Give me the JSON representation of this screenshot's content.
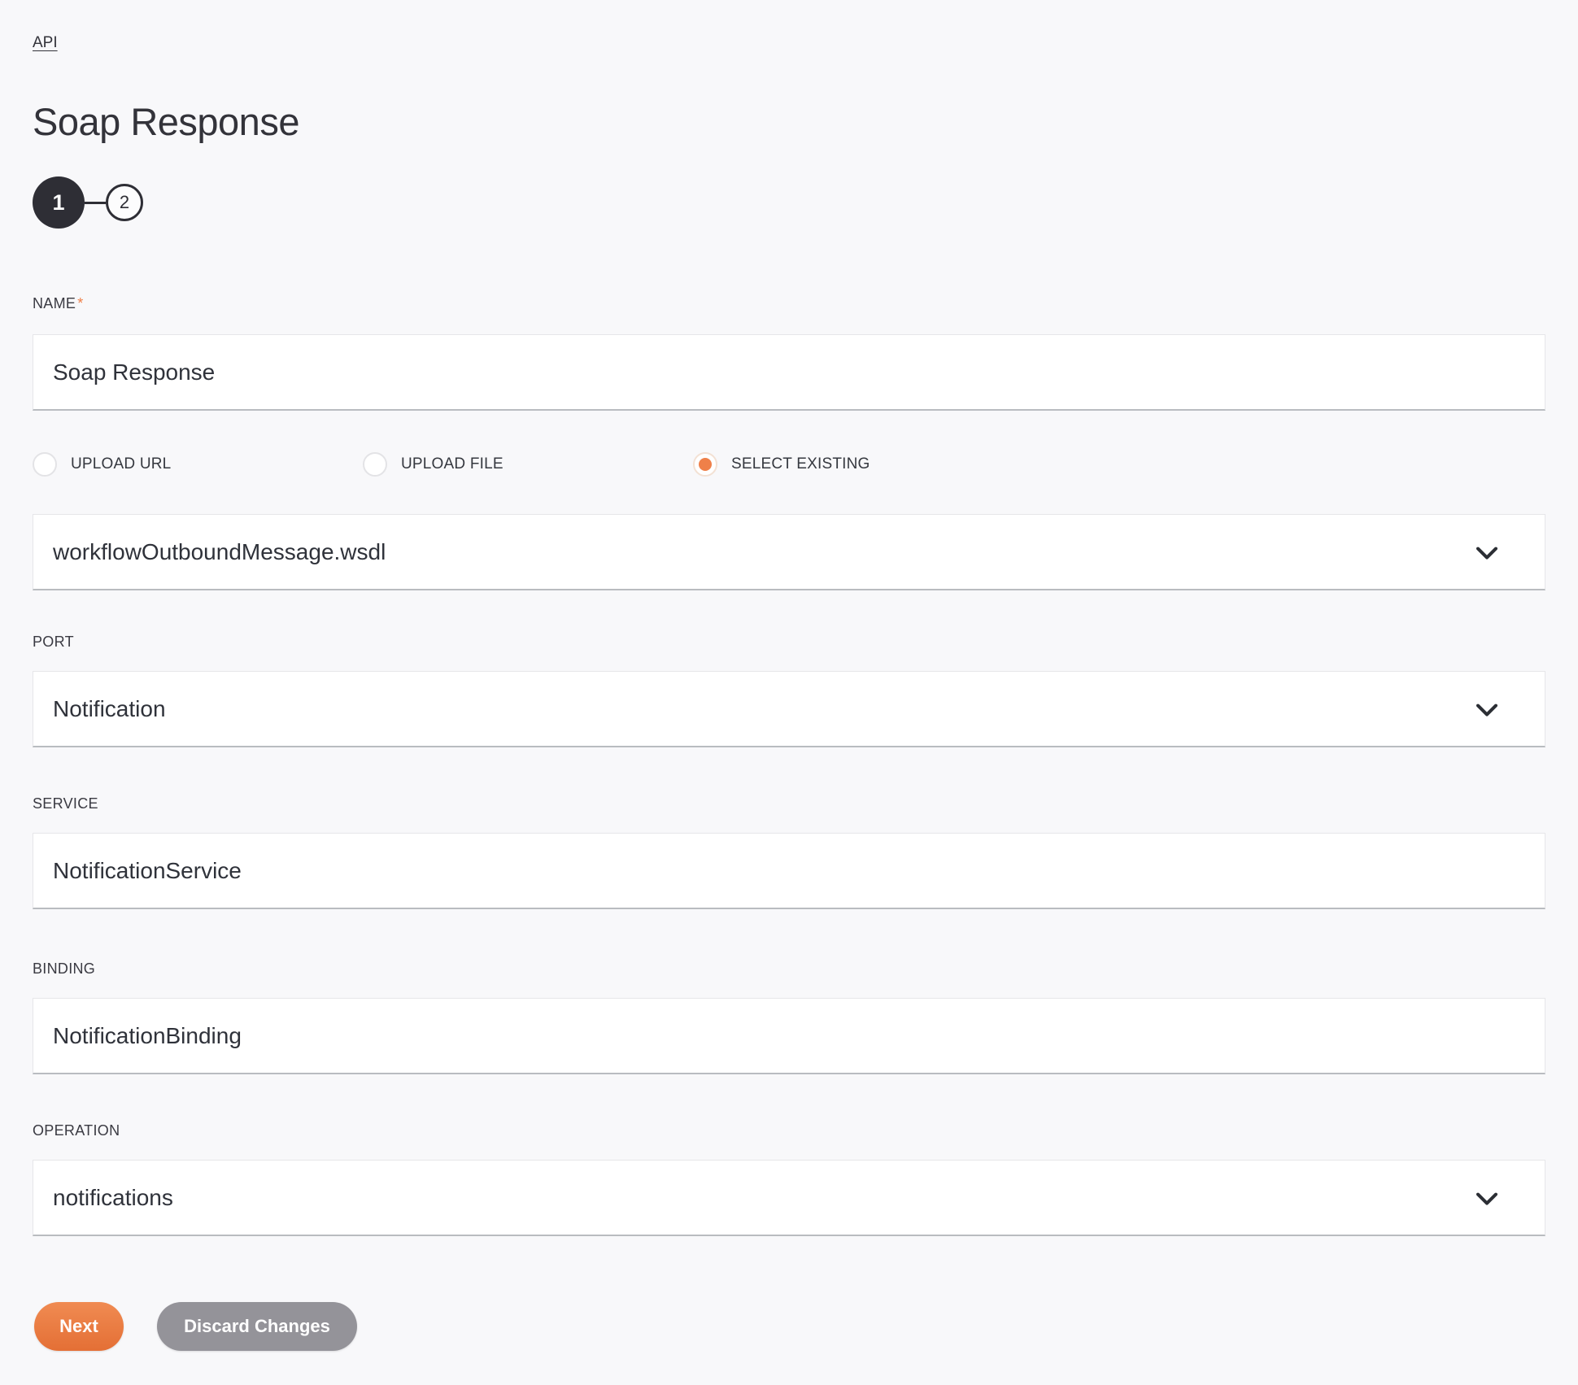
{
  "colors": {
    "background": "#f8f8fa",
    "accent_orange": "#ef8049",
    "stepper_dark": "#2e2e35",
    "button_gray": "#949399"
  },
  "breadcrumb": {
    "label": "API"
  },
  "header": {
    "title": "Soap Response"
  },
  "stepper": {
    "steps": [
      {
        "number": "1",
        "active": true
      },
      {
        "number": "2",
        "active": false
      }
    ]
  },
  "form": {
    "name": {
      "label": "NAME",
      "required_marker": "*",
      "value": "Soap Response"
    },
    "source_options": [
      {
        "label": "UPLOAD URL",
        "selected": false
      },
      {
        "label": "UPLOAD FILE",
        "selected": false
      },
      {
        "label": "SELECT EXISTING",
        "selected": true
      }
    ],
    "wsdl": {
      "value": "workflowOutboundMessage.wsdl"
    },
    "port": {
      "label": "PORT",
      "value": "Notification"
    },
    "service": {
      "label": "SERVICE",
      "value": "NotificationService"
    },
    "binding": {
      "label": "BINDING",
      "value": "NotificationBinding"
    },
    "operation": {
      "label": "OPERATION",
      "value": "notifications"
    }
  },
  "actions": {
    "next_label": "Next",
    "discard_label": "Discard Changes"
  }
}
